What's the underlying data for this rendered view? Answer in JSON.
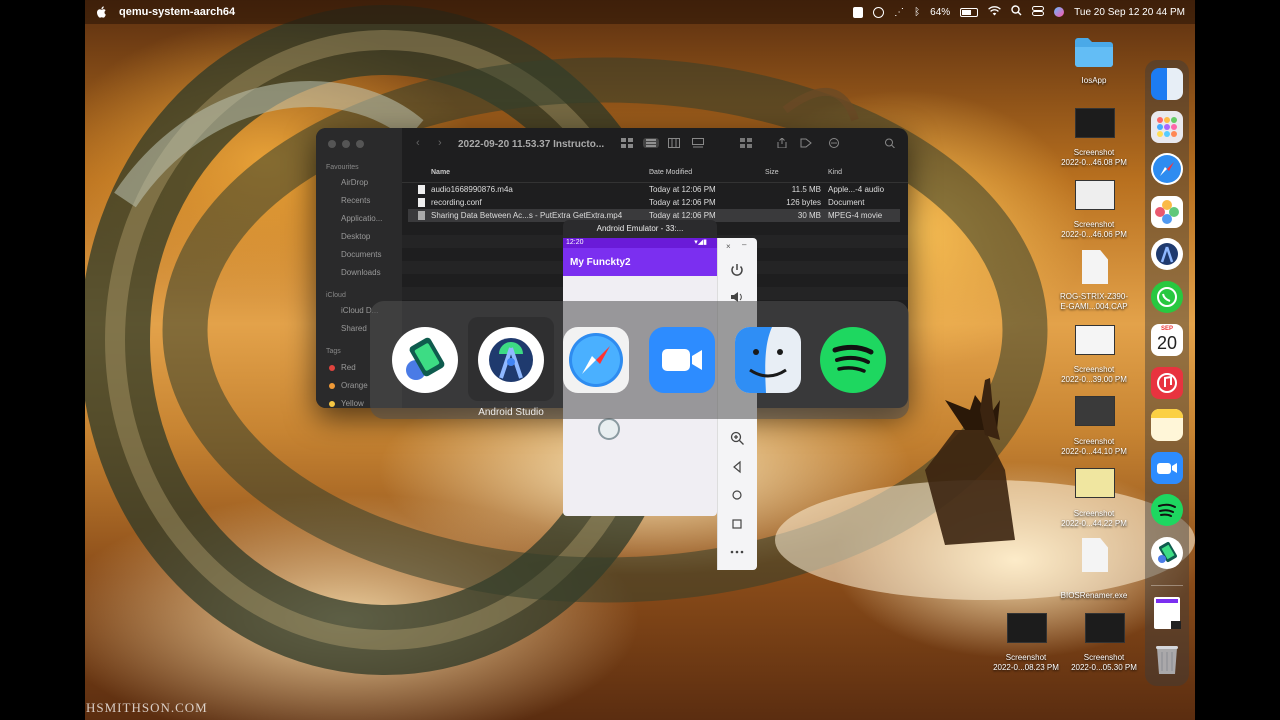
{
  "menubar": {
    "app_name": "qemu-system-aarch64",
    "battery": "64%",
    "datetime": "Tue 20 Sep  12 20 44 PM"
  },
  "finder": {
    "title": "2022-09-20 11.53.37 Instructo...",
    "sidebar": {
      "favourites_header": "Favourites",
      "favourites": [
        "AirDrop",
        "Recents",
        "Applicatio...",
        "Desktop",
        "Documents",
        "Downloads"
      ],
      "icloud_header": "iCloud",
      "icloud": [
        "iCloud D...",
        "Shared"
      ],
      "tags_header": "Tags",
      "tags": [
        {
          "name": "Red",
          "color": "#e0443e"
        },
        {
          "name": "Orange",
          "color": "#f09a37"
        },
        {
          "name": "Yellow",
          "color": "#f6c744"
        }
      ]
    },
    "columns": {
      "name": "Name",
      "date": "Date Modified",
      "size": "Size",
      "kind": "Kind"
    },
    "files": [
      {
        "name": "audio1668990876.m4a",
        "date": "Today at 12:06 PM",
        "size": "11.5 MB",
        "kind": "Apple...-4 audio"
      },
      {
        "name": "recording.conf",
        "date": "Today at 12:06 PM",
        "size": "126 bytes",
        "kind": "Document"
      },
      {
        "name": "Sharing Data Between Ac...s - PutExtra GetExtra.mp4",
        "date": "Today at 12:06 PM",
        "size": "30 MB",
        "kind": "MPEG-4 movie"
      }
    ]
  },
  "emulator": {
    "window_title": "Android Emulator - 33:...",
    "status_time": "12:20",
    "app_title": "My Funckty2"
  },
  "app_switcher": {
    "selected_label": "Android Studio",
    "apps": [
      "android-emulator-icon",
      "android-studio-icon",
      "safari-icon",
      "zoom-icon",
      "finder-icon",
      "spotify-icon"
    ]
  },
  "desktop_icons": [
    {
      "label1": "IosApp",
      "label2": ""
    },
    {
      "label1": "Screenshot",
      "label2": "2022-0...46.08 PM"
    },
    {
      "label1": "Screenshot",
      "label2": "2022-0...46.06 PM"
    },
    {
      "label1": "ROG-STRIX-Z390-",
      "label2": "E-GAMI...004.CAP"
    },
    {
      "label1": "Screenshot",
      "label2": "2022-0...39.00 PM"
    },
    {
      "label1": "Screenshot",
      "label2": "2022-0...44.10 PM"
    },
    {
      "label1": "Screenshot",
      "label2": "2022-0...44.22 PM"
    },
    {
      "label1": "BIOSRenamer.exe",
      "label2": ""
    },
    {
      "label1": "Screenshot",
      "label2": "2022-0...08.23 PM"
    },
    {
      "label1": "Screenshot",
      "label2": "2022-0...05.30 PM"
    }
  ],
  "dock": {
    "calendar_month": "SEP",
    "calendar_day": "20"
  },
  "watermark": "HSMITHSON.COM"
}
